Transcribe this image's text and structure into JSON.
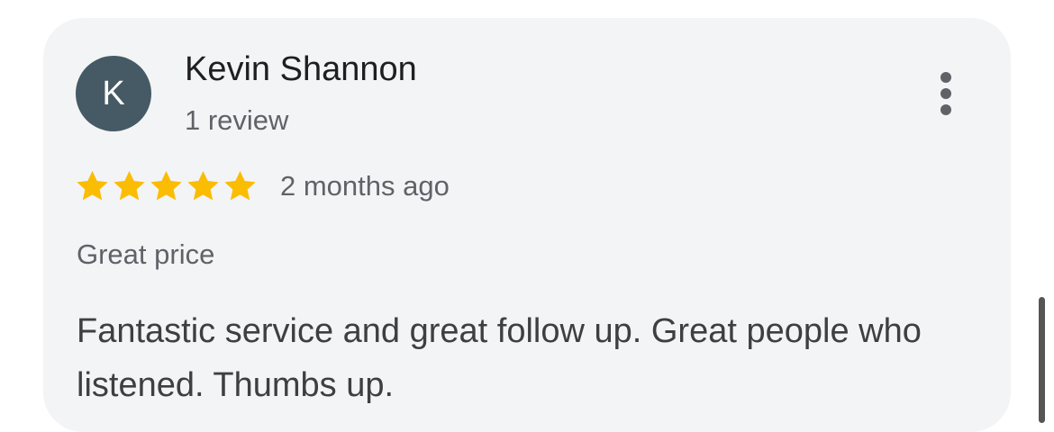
{
  "review": {
    "avatar_initial": "K",
    "reviewer_name": "Kevin Shannon",
    "review_count": "1 review",
    "rating": 5,
    "rating_max": 5,
    "date": "2 months ago",
    "topic": "Great price",
    "text": "Fantastic service and great follow up. Great people who listened. Thumbs up."
  },
  "icons": {
    "star": "star-icon",
    "more": "more-vert-icon"
  },
  "colors": {
    "avatar_bg": "#455a64",
    "star": "#fbbc04",
    "card_bg": "#f3f4f6"
  }
}
